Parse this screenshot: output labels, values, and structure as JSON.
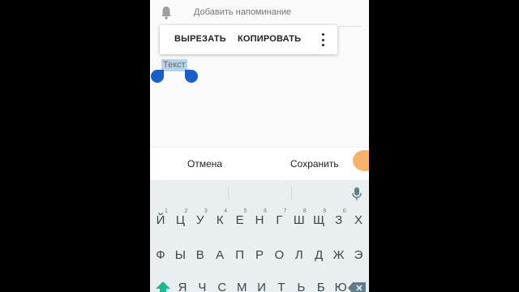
{
  "reminder": {
    "text": "Добавить напоминание",
    "icon": "bell-icon"
  },
  "toolbar": {
    "cut": "ВЫРЕЗАТЬ",
    "copy": "КОПИРОВАТЬ",
    "more_icon": "more-vert-icon"
  },
  "selection": {
    "text": "Текст"
  },
  "dialog": {
    "cancel": "Отмена",
    "save": "Сохранить"
  },
  "keyboard": {
    "row1": [
      "Й",
      "Ц",
      "У",
      "К",
      "Е",
      "Н",
      "Г",
      "Ш",
      "Щ",
      "З",
      "Х"
    ],
    "row1_hints": [
      "1",
      "2",
      "3",
      "4",
      "5",
      "6",
      "7",
      "8",
      "9",
      "0",
      ""
    ],
    "row2": [
      "Ф",
      "Ы",
      "В",
      "А",
      "П",
      "Р",
      "О",
      "Л",
      "Д",
      "Ж",
      "Э"
    ],
    "row3": [
      "Я",
      "Ч",
      "С",
      "М",
      "И",
      "Т",
      "Ь",
      "Б",
      "Ю"
    ]
  },
  "colors": {
    "handle": "#1a5fc9",
    "selection": "#b7d2ec",
    "fab": "#f7b267",
    "keyboard_bg": "#e9eef0"
  }
}
